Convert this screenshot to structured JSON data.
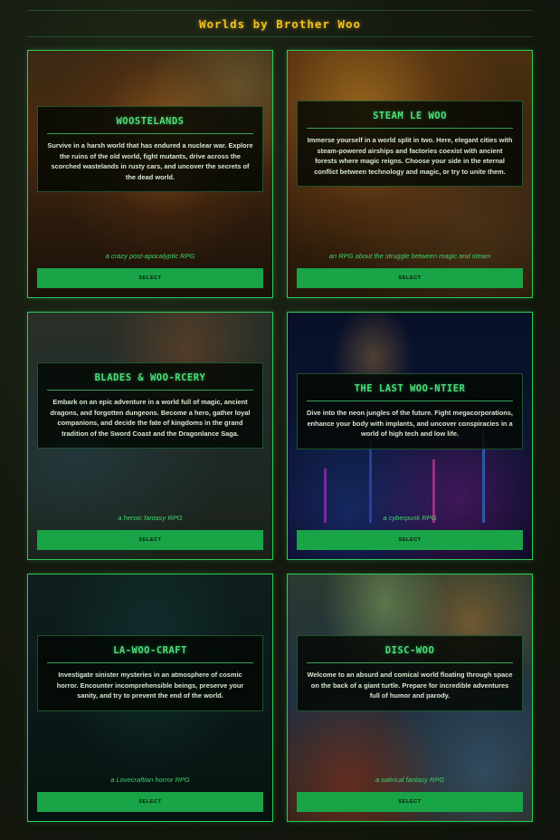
{
  "header": {
    "title": "Worlds by Brother Woo"
  },
  "worlds": [
    {
      "title": "WOOSTELANDS",
      "description": "Survive in a harsh world that has endured a nuclear war. Explore the ruins of the old world, fight mutants, drive across the scorched wastelands in rusty cars, and uncover the secrets of the dead world.",
      "tagline": "a crazy post-apocalyptic RPG",
      "button": "SELECT"
    },
    {
      "title": "STEAM LE WOO",
      "description": "Immerse yourself in a world split in two. Here, elegant cities with steam-powered airships and factories coexist with ancient forests where magic reigns. Choose your side in the eternal conflict between technology and magic, or try to unite them.",
      "tagline": "an RPG about the struggle between magic and steam",
      "button": "SELECT"
    },
    {
      "title": "BLADES & WOO-RCERY",
      "description": "Embark on an epic adventure in a world full of magic, ancient dragons, and forgotten dungeons. Become a hero, gather loyal companions, and decide the fate of kingdoms in the grand tradition of the Sword Coast and the Dragonlance Saga.",
      "tagline": "a heroic fantasy RPG",
      "button": "SELECT"
    },
    {
      "title": "THE LAST WOO-NTIER",
      "description": "Dive into the neon jungles of the future. Fight megacorporations, enhance your body with implants, and uncover conspiracies in a world of high tech and low life.",
      "tagline": "a cyberpunk RPG",
      "button": "SELECT"
    },
    {
      "title": "LA-WOO-CRAFT",
      "description": "Investigate sinister mysteries in an atmosphere of cosmic horror. Encounter incomprehensible beings, preserve your sanity, and try to prevent the end of the world.",
      "tagline": "a Lovecraftian horror RPG",
      "button": "SELECT"
    },
    {
      "title": "DISC-WOO",
      "description": "Welcome to an absurd and comical world floating through space on the back of a giant turtle. Prepare for incredible adventures full of humor and parody.",
      "tagline": "a satirical fantasy RPG",
      "button": "SELECT"
    }
  ],
  "colors": {
    "accent": "#2ecc55",
    "heading": "#4be07a",
    "title": "#f0c020",
    "button": "#19a447"
  }
}
